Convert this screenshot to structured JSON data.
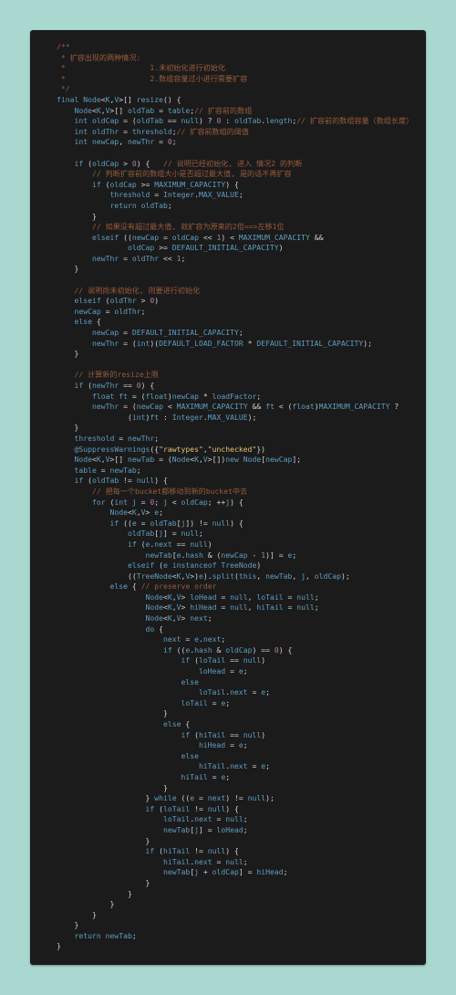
{
  "code": {
    "language": "java",
    "colors": {
      "background": "#1b1b1b",
      "page_background": "#a8d8cf",
      "comment": "#9a5b3c",
      "string": "#e3c27a",
      "number": "#b27aa6",
      "identifier": "#5f9dc0",
      "punctuation": "#d2d2d2"
    },
    "lines": [
      "/**",
      " * 扩容出现的两种情况:",
      " *                   1.未初始化进行初始化",
      " *                   2.数组容量过小进行需要扩容",
      " */",
      "final Node<K,V>[] resize() {",
      "    Node<K,V>[] oldTab = table;// 扩容前的数组",
      "    int oldCap = (oldTab == null) ? 0 : oldTab.length;// 扩容前的数组容量（数组长度）",
      "    int oldThr = threshold;// 扩容前数组的阈值",
      "    int newCap, newThr = 0;",
      "",
      "    if (oldCap > 0) {   // 说明已经初始化, 进入 情况2 的判断",
      "        // 判断扩容前的数组大小是否超过最大值, 是的话不再扩容",
      "        if (oldCap >= MAXIMUM_CAPACITY) {",
      "            threshold = Integer.MAX_VALUE;",
      "            return oldTab;",
      "        }",
      "        // 如果没有超过最大值, 就扩容为原来的2倍==>左移1位",
      "        elseif ((newCap = oldCap << 1) < MAXIMUM_CAPACITY &&",
      "                oldCap >= DEFAULT_INITIAL_CAPACITY)",
      "        newThr = oldThr << 1;",
      "    }",
      "",
      "    // 说明尚未初始化, 则要进行初始化",
      "    elseif (oldThr > 0)",
      "    newCap = oldThr;",
      "    else {",
      "        newCap = DEFAULT_INITIAL_CAPACITY;",
      "        newThr = (int)(DEFAULT_LOAD_FACTOR * DEFAULT_INITIAL_CAPACITY);",
      "    }",
      "",
      "    // 计算新的resize上限",
      "    if (newThr == 0) {",
      "        float ft = (float)newCap * loadFactor;",
      "        newThr = (newCap < MAXIMUM_CAPACITY && ft < (float)MAXIMUM_CAPACITY ?",
      "                (int)ft : Integer.MAX_VALUE);",
      "    }",
      "    threshold = newThr;",
      "    @SuppressWarnings({\"rawtypes\",\"unchecked\"})",
      "    Node<K,V>[] newTab = (Node<K,V>[])new Node[newCap];",
      "    table = newTab;",
      "    if (oldTab != null) {",
      "        // 把每一个bucket都移动到新的bucket中去",
      "        for (int j = 0; j < oldCap; ++j) {",
      "            Node<K,V> e;",
      "            if ((e = oldTab[j]) != null) {",
      "                oldTab[j] = null;",
      "                if (e.next == null)",
      "                    newTab[e.hash & (newCap - 1)] = e;",
      "                elseif (e instanceof TreeNode)",
      "                ((TreeNode<K,V>)e).split(this, newTab, j, oldCap);",
      "            else { // preserve order",
      "                    Node<K,V> loHead = null, loTail = null;",
      "                    Node<K,V> hiHead = null, hiTail = null;",
      "                    Node<K,V> next;",
      "                    do {",
      "                        next = e.next;",
      "                        if ((e.hash & oldCap) == 0) {",
      "                            if (loTail == null)",
      "                                loHead = e;",
      "                            else",
      "                                loTail.next = e;",
      "                            loTail = e;",
      "                        }",
      "                        else {",
      "                            if (hiTail == null)",
      "                                hiHead = e;",
      "                            else",
      "                                hiTail.next = e;",
      "                            hiTail = e;",
      "                        }",
      "                    } while ((e = next) != null);",
      "                    if (loTail != null) {",
      "                        loTail.next = null;",
      "                        newTab[j] = loHead;",
      "                    }",
      "                    if (hiTail != null) {",
      "                        hiTail.next = null;",
      "                        newTab[j + oldCap] = hiHead;",
      "                    }",
      "                }",
      "            }",
      "        }",
      "    }",
      "    return newTab;",
      "}"
    ]
  }
}
